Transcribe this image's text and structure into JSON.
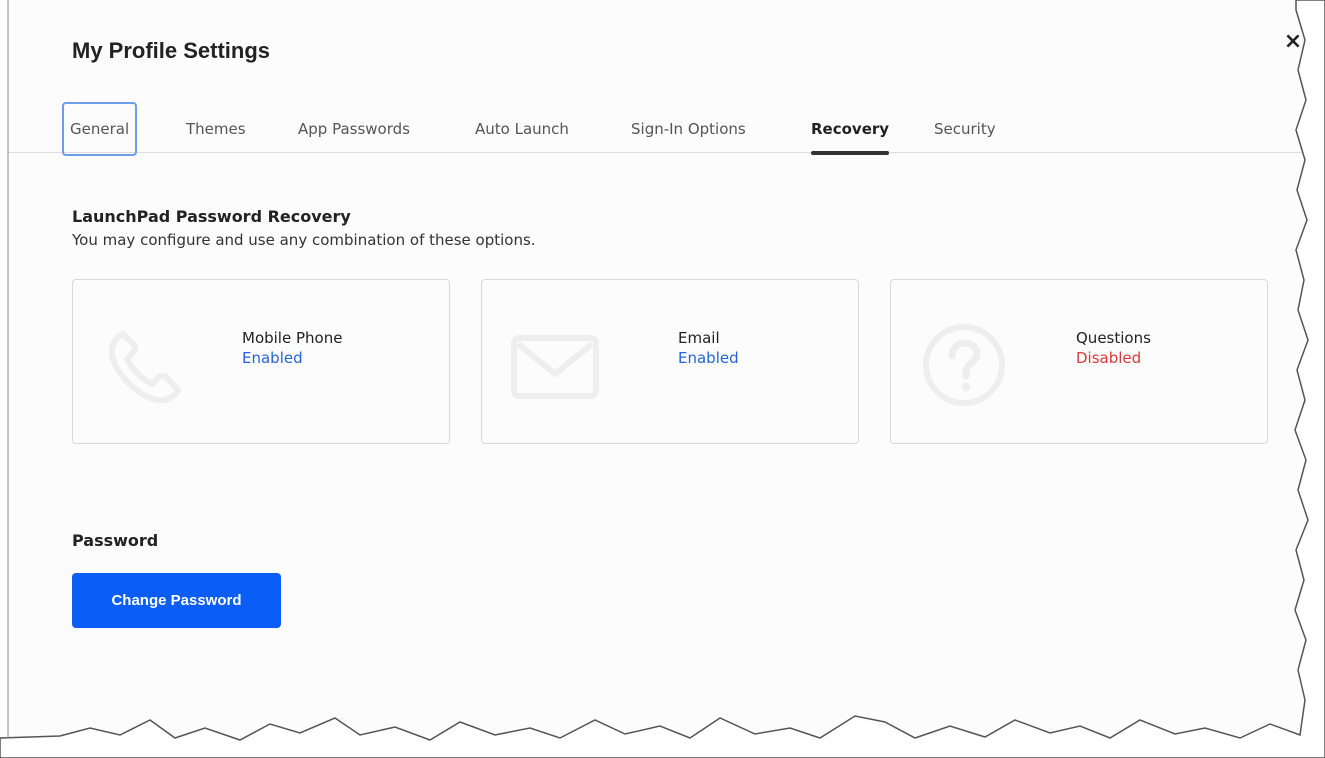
{
  "dialog": {
    "title": "My Profile Settings",
    "close_label": "×"
  },
  "tabs": [
    {
      "label": "General",
      "state": "focused"
    },
    {
      "label": "Themes"
    },
    {
      "label": "App Passwords"
    },
    {
      "label": "Auto Launch"
    },
    {
      "label": "Sign-In Options"
    },
    {
      "label": "Recovery",
      "state": "active"
    },
    {
      "label": "Security"
    }
  ],
  "recovery": {
    "title": "LaunchPad Password Recovery",
    "description": "You may configure and use any combination of these options.",
    "options": [
      {
        "label": "Mobile Phone",
        "status": "Enabled",
        "icon": "phone-icon",
        "status_color": "#2563d9"
      },
      {
        "label": "Email",
        "status": "Enabled",
        "icon": "envelope-icon",
        "status_color": "#2563d9"
      },
      {
        "label": "Questions",
        "status": "Disabled",
        "icon": "question-circle-icon",
        "status_color": "#d63b3b"
      }
    ]
  },
  "password": {
    "title": "Password",
    "button_label": "Change Password"
  },
  "colors": {
    "primary_button": "#0a5ef5",
    "enabled": "#2563d9",
    "disabled": "#d63b3b",
    "focus_ring": "#6d9eea"
  }
}
